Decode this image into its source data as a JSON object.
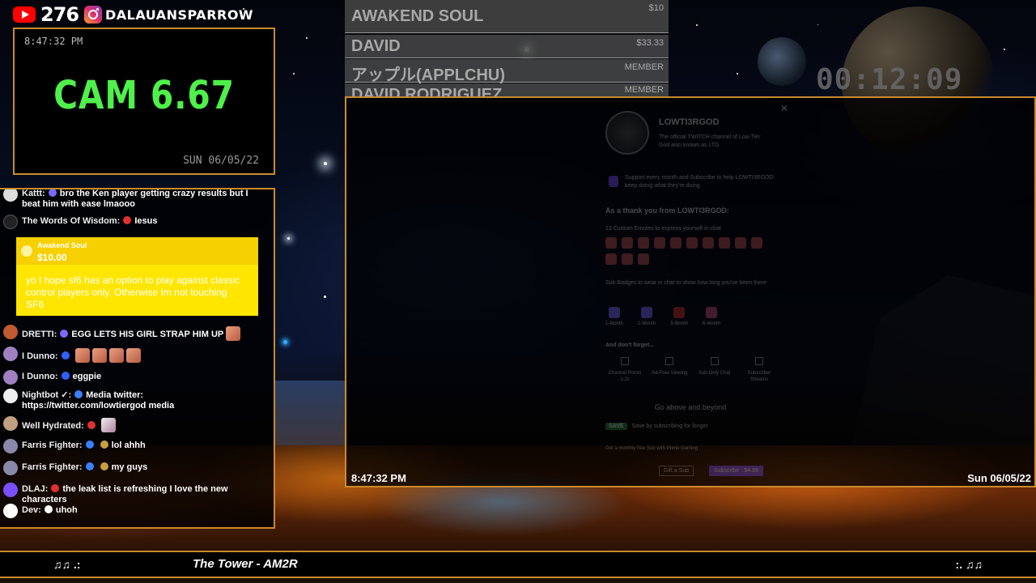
{
  "social": {
    "youtube_count": "276",
    "instagram_handle": "DALAUANSPARROW"
  },
  "cam": {
    "time": "8:47:32 PM",
    "label": "CAM 6.67",
    "date": "SUN 06/05/22",
    "label_color": "#4ff04a"
  },
  "alerts": [
    {
      "name": "AWAKEND SOUL",
      "value": "$10"
    },
    {
      "name": "DAVID",
      "value": "$33.33"
    },
    {
      "name": "アップル(APPLCHU)",
      "value": "MEMBER"
    },
    {
      "name": "DAVID RODRIGUEZ",
      "value": "MEMBER"
    }
  ],
  "timer": "00:12:09",
  "chat": {
    "messages": [
      {
        "user": "Kattt:",
        "text": "bro the Ken player getting crazy results but I beat him with ease lmaooo",
        "avatar_color": "#ddd",
        "badge_color": "#7a6aff"
      },
      {
        "user": "The Words Of Wisdom:",
        "text": "Iesus",
        "avatar_color": "#222",
        "badge_color": "#e03030"
      },
      {
        "user": "DRETTI:",
        "text": "EGG LETS HIS GIRL STRAP HIM UP",
        "avatar_color": "#c05a30",
        "badge_color": "#7a6aff"
      },
      {
        "user": "I Dunno:",
        "text": "",
        "avatar_color": "#a080c0",
        "badge_color": "#3060ff"
      },
      {
        "user": "I Dunno:",
        "text": "eggpie",
        "avatar_color": "#a080c0",
        "badge_color": "#3060ff"
      },
      {
        "user": "Nightbot ✓:",
        "text": "Media twitter: https://twitter.com/lowtiergod media",
        "avatar_color": "#eee",
        "badge_color": "#3a80ff"
      },
      {
        "user": "Well Hydrated:",
        "text": "",
        "avatar_color": "#c0a080",
        "badge_color": "#e03030"
      },
      {
        "user": "Farris Fighter:",
        "text": "lol ahhh",
        "avatar_color": "#8888aa",
        "badge_color": "#3a80ff"
      },
      {
        "user": "Farris Fighter:",
        "text": "my guys",
        "avatar_color": "#8888aa",
        "badge_color": "#3a80ff"
      },
      {
        "user": "DLAJ:",
        "text": "the leak list is refreshing I love the new characters",
        "avatar_color": "#7a4fff",
        "badge_color": "#e03030"
      },
      {
        "user": "Dev:",
        "text": "uhoh",
        "avatar_color": "#fff",
        "badge_color": "#ffffff"
      }
    ],
    "donation": {
      "name": "Awakend Soul",
      "amount": "$10.00",
      "message": "yo I hope sf6 has an option to play against classic control players only. Otherwise Im not touching SF6"
    }
  },
  "screen": {
    "time": "8:47:32 PM",
    "date": "Sun 06/05/22",
    "panel": {
      "channel_name": "LOWTI3RGOD",
      "description": "The official TWITCH channel of Low Tier God also known as LTG",
      "support_text": "Support every month and Subscribe to help LOWTI3RGOD keep doing what they're doing",
      "thanks_heading": "As a thank you from LOWTI3RGOD:",
      "emotes_label": "13 Custom Emotes to express yourself in chat",
      "badges_label": "Sub Badges to wear in chat to show how long you've been there",
      "badges": [
        "1-Month",
        "2-Month",
        "3-Month",
        "6-Month"
      ],
      "forget_label": "And don't forget...",
      "perks": [
        "Channel Points 1.2x",
        "Ad-Free Viewing",
        "Sub-Only Chat",
        "Subscriber Streams"
      ],
      "beyond_label": "Go above and beyond",
      "save_badge": "SAVE",
      "save_label": "Save by subscribing for longer",
      "prime_label": "Get a monthly free Sub with Prime Gaming",
      "gift_label": "Gift a Sub",
      "subscribe_label": "Subscribe · $4.99"
    }
  },
  "music": {
    "note_left": "♫♫ .:",
    "song": "The Tower - AM2R",
    "note_right": ":. ♫♫"
  }
}
